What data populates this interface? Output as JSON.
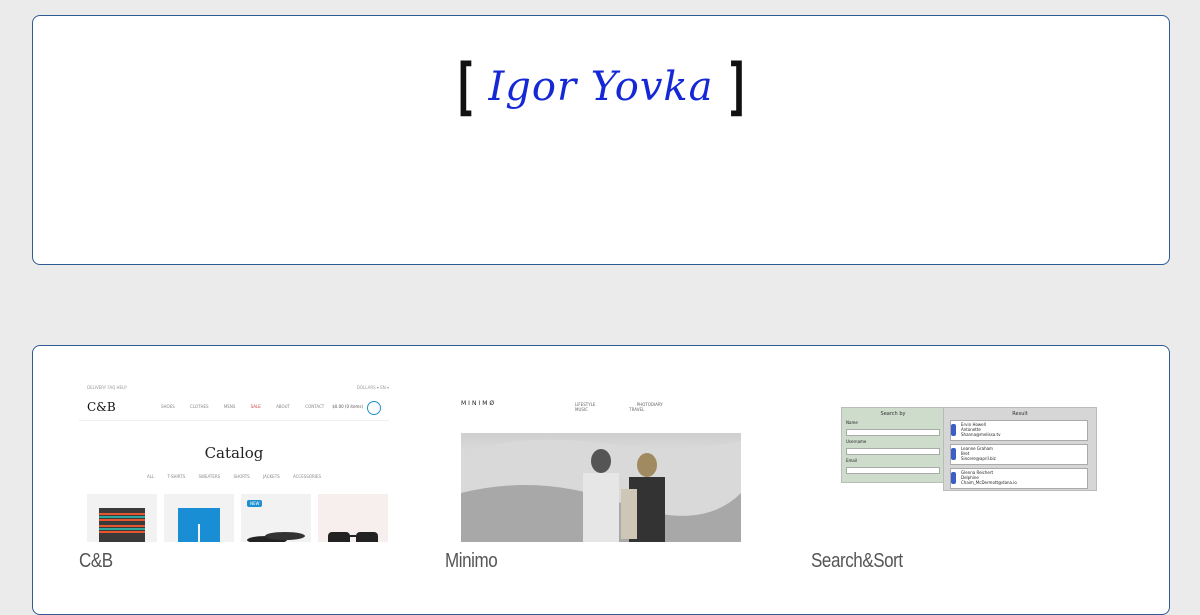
{
  "logo": {
    "bracket_open": "[",
    "name": "Igor Yovka",
    "bracket_close": "]",
    "name_color": "#1428d6"
  },
  "portfolio": {
    "cards": [
      {
        "caption": "C&B",
        "thumbnail": {
          "topbar_left": "DELIVERY   FAQ   HELP",
          "topbar_right": "DOLLARS ▾   EN ▾",
          "logo": "C&B",
          "menu": [
            "SHOES",
            "CLOTHES",
            "MENS",
            "SALE",
            "ABOUT",
            "CONTACT"
          ],
          "cart_total": "$0.00 (0 items)",
          "title": "Catalog",
          "filters": [
            "ALL",
            "T-SHIRTS",
            "SWEATERS",
            "SHORTS",
            "JACKETS",
            "ACCESSORIES"
          ],
          "badge": "NEW"
        }
      },
      {
        "caption": "Minimo",
        "thumbnail": {
          "logo": "MINIMØ",
          "menu": [
            "LIFESTYLE",
            "PHOTODIARY",
            "MUSIC",
            "TRAVEL"
          ]
        }
      },
      {
        "caption": "Search&Sort",
        "thumbnail": {
          "search_title": "Search by",
          "fields": [
            "Name",
            "Username",
            "Email"
          ],
          "result_title": "Result",
          "results": [
            {
              "name": "Ervin Howell",
              "username": "Antonette",
              "email": "Shanna@melissa.tv"
            },
            {
              "name": "Leanne Graham",
              "username": "Bret",
              "email": "Sincere@april.biz"
            },
            {
              "name": "Glenna Reichert",
              "username": "Delphine",
              "email": "Chaim_McDermott@dana.io"
            }
          ]
        }
      }
    ]
  }
}
